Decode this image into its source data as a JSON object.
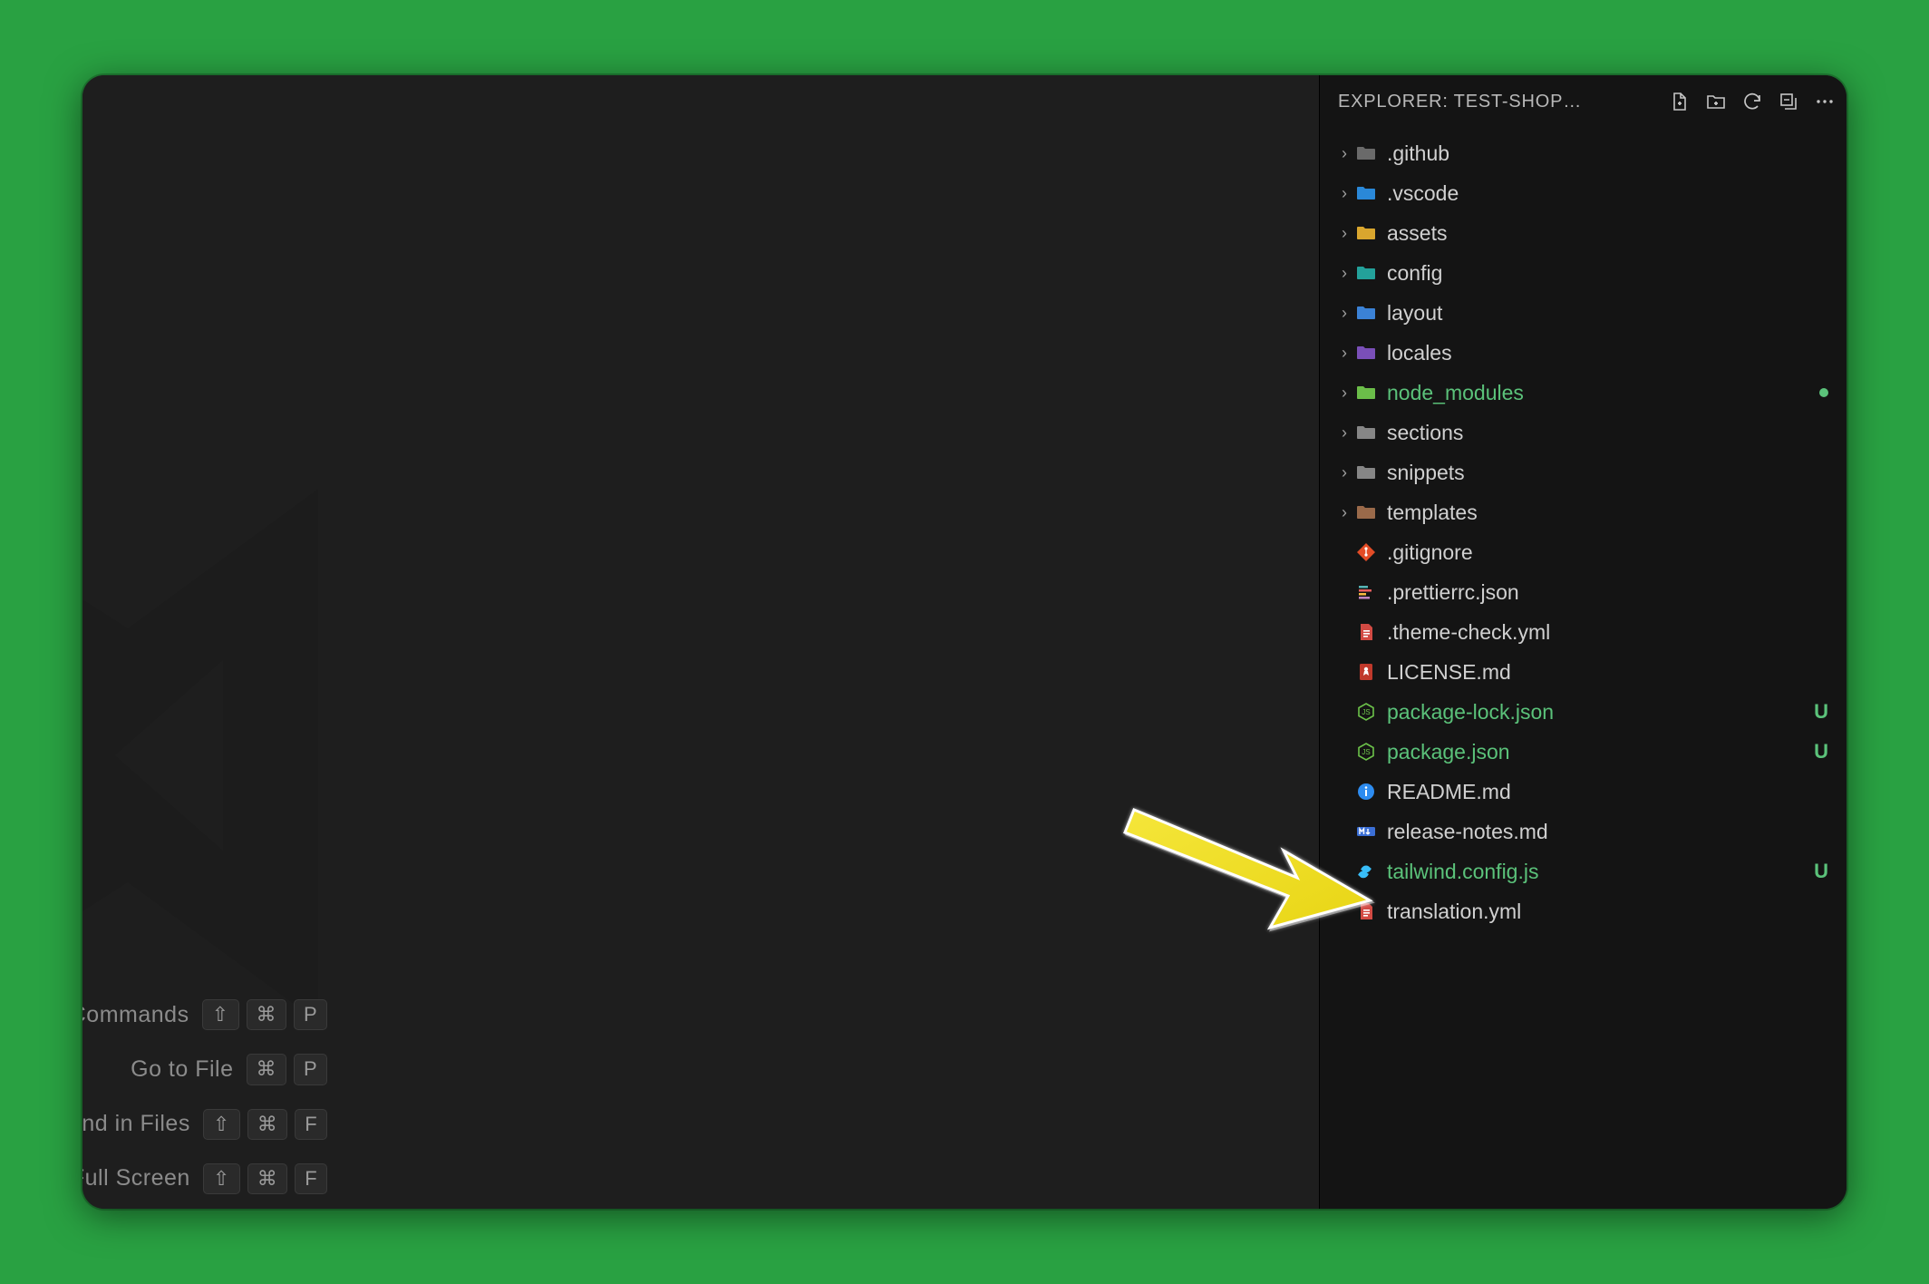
{
  "explorer": {
    "title": "EXPLORER: TEST-SHOP…",
    "tree": [
      {
        "name": ".github",
        "type": "folder",
        "iconColor": "#6a6a6a",
        "dot": "#6bc2e0"
      },
      {
        "name": ".vscode",
        "type": "folder",
        "iconColor": "#2a88d8",
        "dot": "#2a88d8"
      },
      {
        "name": "assets",
        "type": "folder",
        "iconColor": "#d9a62e"
      },
      {
        "name": "config",
        "type": "folder",
        "iconColor": "#23a19a"
      },
      {
        "name": "layout",
        "type": "folder",
        "iconColor": "#3b82d6"
      },
      {
        "name": "locales",
        "type": "folder",
        "iconColor": "#7a4fb8"
      },
      {
        "name": "node_modules",
        "type": "folder",
        "iconColor": "#6bbd49",
        "green": true,
        "dotStatus": true
      },
      {
        "name": "sections",
        "type": "folder",
        "iconColor": "#868686"
      },
      {
        "name": "snippets",
        "type": "folder",
        "iconColor": "#868686"
      },
      {
        "name": "templates",
        "type": "folder",
        "iconColor": "#9a6a4a"
      },
      {
        "name": ".gitignore",
        "type": "file",
        "icon": "git"
      },
      {
        "name": ".prettierrc.json",
        "type": "file",
        "icon": "prettier"
      },
      {
        "name": ".theme-check.yml",
        "type": "file",
        "icon": "yml-red"
      },
      {
        "name": "LICENSE.md",
        "type": "file",
        "icon": "license"
      },
      {
        "name": "package-lock.json",
        "type": "file",
        "icon": "npm",
        "green": true,
        "status": "U"
      },
      {
        "name": "package.json",
        "type": "file",
        "icon": "npm",
        "green": true,
        "status": "U"
      },
      {
        "name": "README.md",
        "type": "file",
        "icon": "info"
      },
      {
        "name": "release-notes.md",
        "type": "file",
        "icon": "mdx"
      },
      {
        "name": "tailwind.config.js",
        "type": "file",
        "icon": "tailwind",
        "green": true,
        "status": "U"
      },
      {
        "name": "translation.yml",
        "type": "file",
        "icon": "yml-red"
      }
    ]
  },
  "welcome": {
    "commands": [
      {
        "label": "ow All Commands",
        "keys": [
          "⇧",
          "⌘",
          "P"
        ]
      },
      {
        "label": "Go to File",
        "keys": [
          "⌘",
          "P"
        ]
      },
      {
        "label": "Find in Files",
        "keys": [
          "⇧",
          "⌘",
          "F"
        ]
      },
      {
        "label": "ggle Full Screen",
        "keys": [
          "⇧",
          "⌘",
          "F"
        ]
      }
    ]
  }
}
